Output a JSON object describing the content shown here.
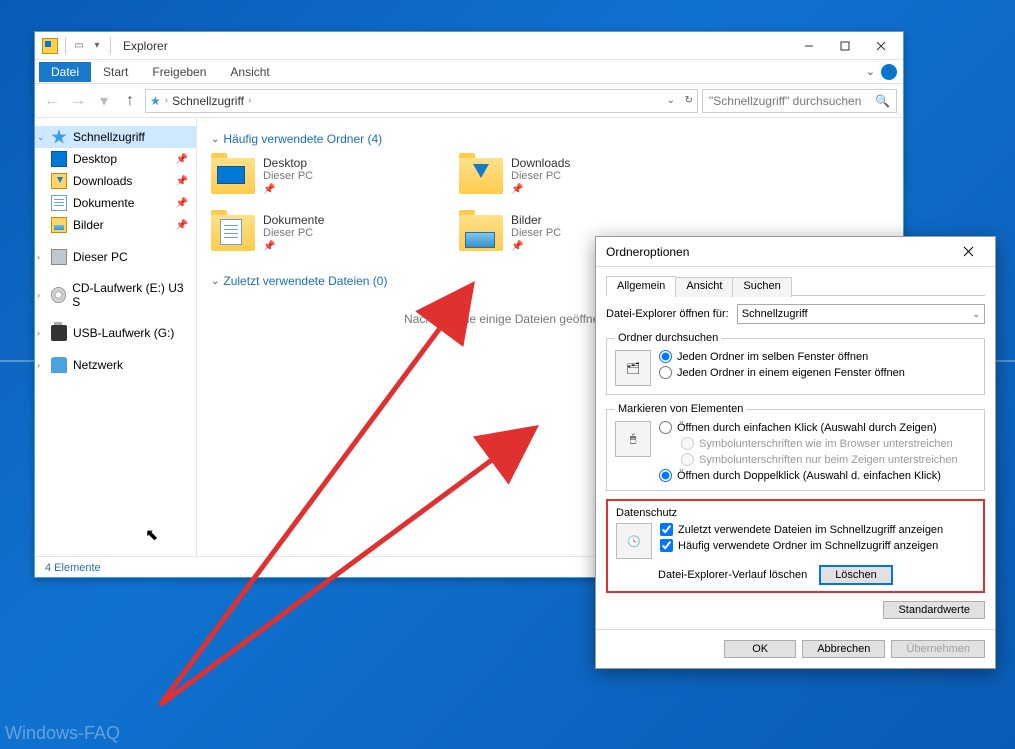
{
  "explorer": {
    "title": "Explorer",
    "ribbon": {
      "file": "Datei",
      "start": "Start",
      "share": "Freigeben",
      "view": "Ansicht"
    },
    "breadcrumb": {
      "root": "Schnellzugriff"
    },
    "search_placeholder": "\"Schnellzugriff\" durchsuchen",
    "nav": {
      "quick": "Schnellzugriff",
      "desktop": "Desktop",
      "downloads": "Downloads",
      "documents": "Dokumente",
      "bilder": "Bilder",
      "pc": "Dieser PC",
      "cd": "CD-Laufwerk (E:) U3 S",
      "usb": "USB-Laufwerk (G:)",
      "net": "Netzwerk"
    },
    "sections": {
      "frequent": "Häufig verwendete Ordner (4)",
      "recent": "Zuletzt verwendete Dateien (0)"
    },
    "folders": {
      "desktop": {
        "name": "Desktop",
        "sub": "Dieser PC"
      },
      "downloads": {
        "name": "Downloads",
        "sub": "Dieser PC"
      },
      "documents": {
        "name": "Dokumente",
        "sub": "Dieser PC"
      },
      "bilder": {
        "name": "Bilder",
        "sub": "Dieser PC"
      }
    },
    "empty_msg": "Nachdem Sie einige Dateien geöffnet haben, zeigen wi",
    "status": "4 Elemente"
  },
  "dialog": {
    "title": "Ordneroptionen",
    "tabs": {
      "general": "Allgemein",
      "view": "Ansicht",
      "search": "Suchen"
    },
    "open_for_label": "Datei-Explorer öffnen für:",
    "open_for_value": "Schnellzugriff",
    "browse": {
      "legend": "Ordner durchsuchen",
      "same": "Jeden Ordner im selben Fenster öffnen",
      "own": "Jeden Ordner in einem eigenen Fenster öffnen"
    },
    "click": {
      "legend": "Markieren von Elementen",
      "single": "Öffnen durch einfachen Klick (Auswahl durch Zeigen)",
      "ul_browser": "Symbolunterschriften wie im Browser unterstreichen",
      "ul_point": "Symbolunterschriften nur beim Zeigen unterstreichen",
      "double": "Öffnen durch Doppelklick (Auswahl d. einfachen Klick)"
    },
    "privacy": {
      "legend": "Datenschutz",
      "recent_files": "Zuletzt verwendete Dateien im Schnellzugriff anzeigen",
      "frequent_folders": "Häufig verwendete Ordner im Schnellzugriff anzeigen",
      "clear_label": "Datei-Explorer-Verlauf löschen",
      "clear_btn": "Löschen"
    },
    "defaults_btn": "Standardwerte",
    "ok": "OK",
    "cancel": "Abbrechen",
    "apply": "Übernehmen"
  },
  "watermark": "Windows-FAQ"
}
